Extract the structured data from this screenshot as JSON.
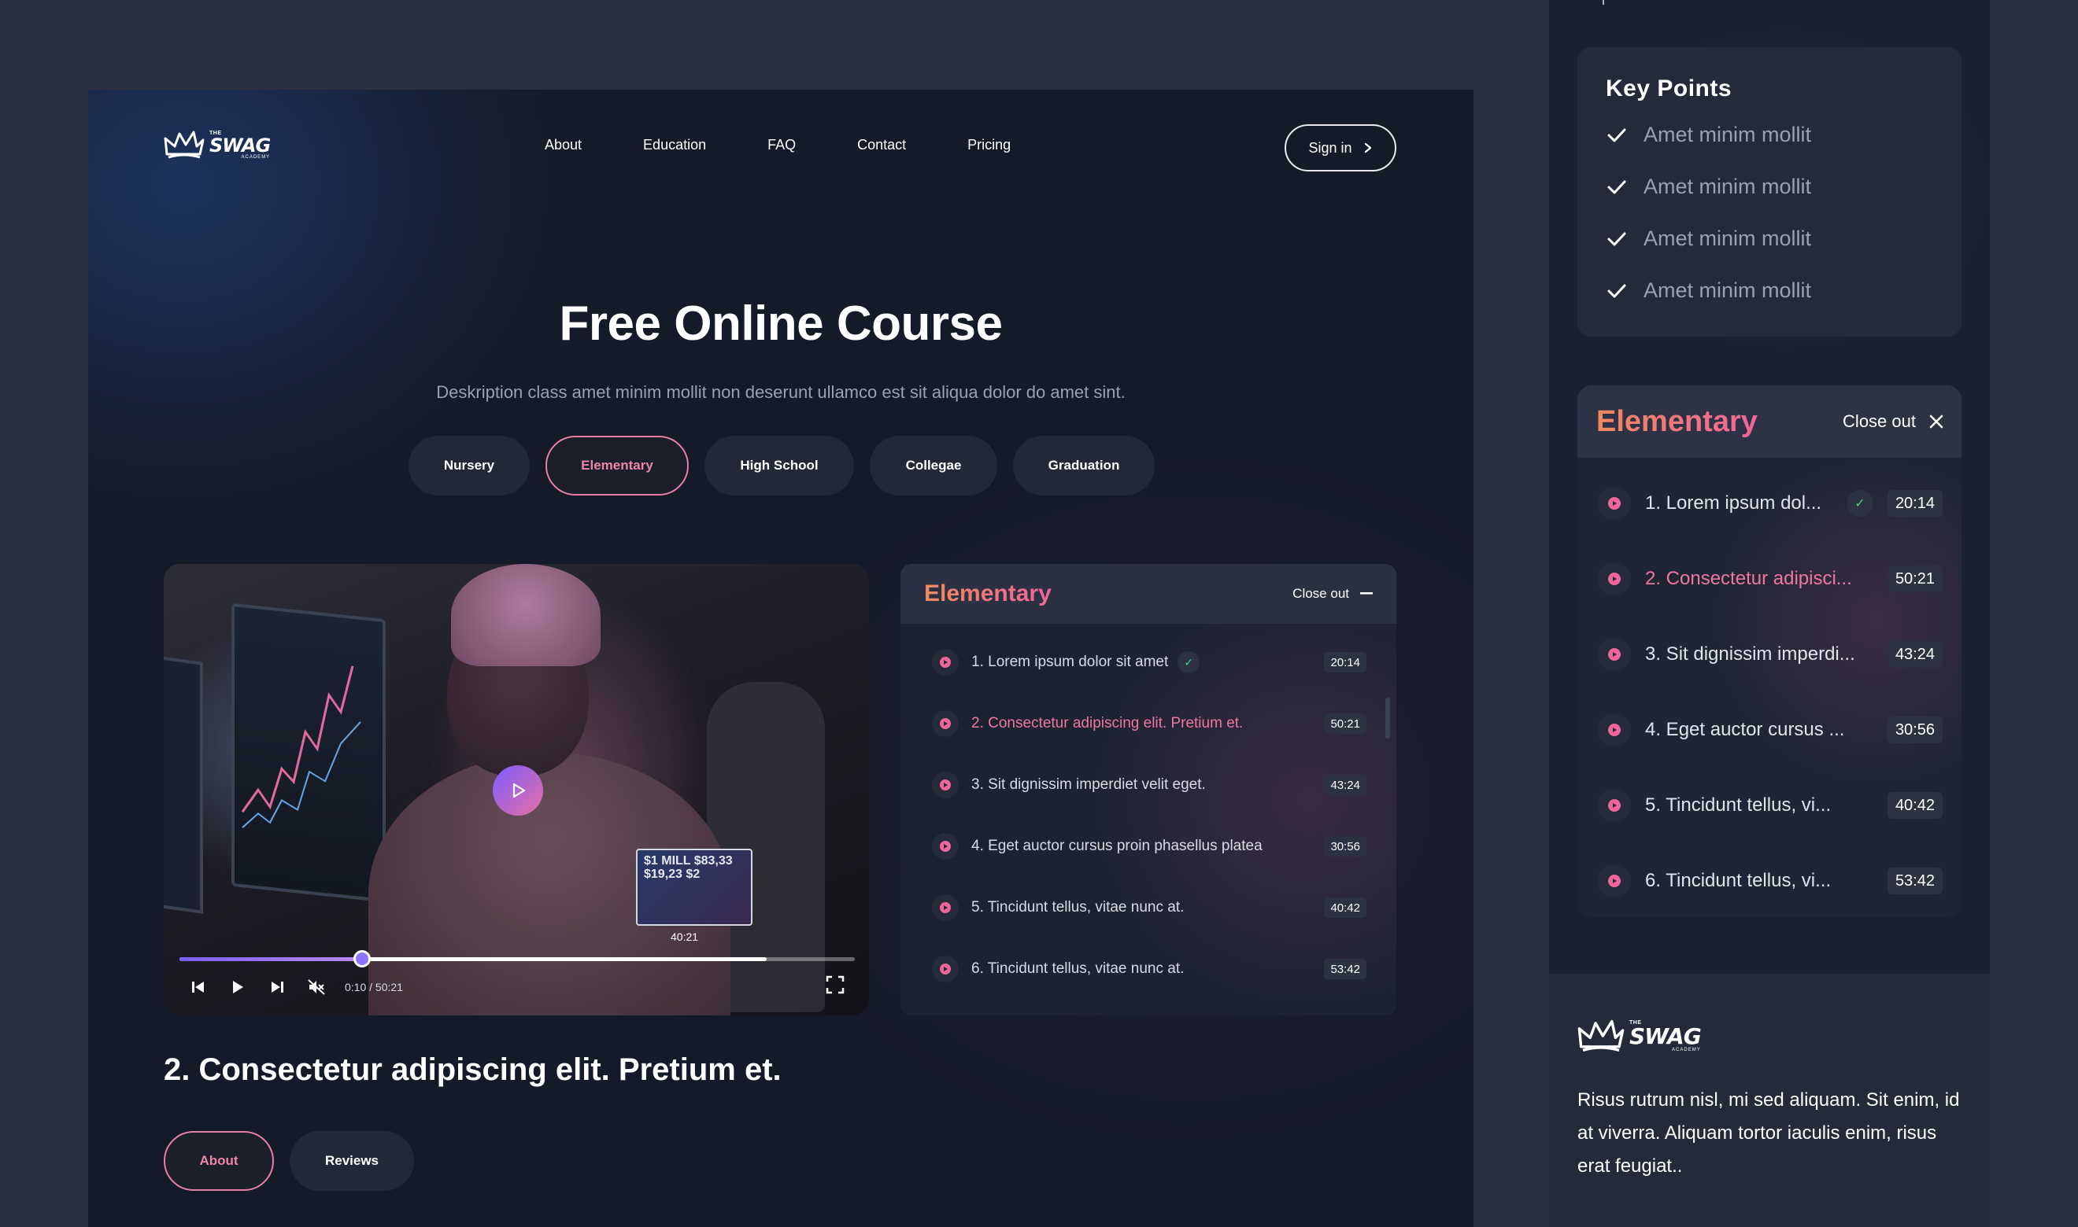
{
  "brand": {
    "the": "THE",
    "name": "SWAG",
    "sub": "ACADEMY"
  },
  "nav": {
    "links": [
      "About",
      "Education",
      "FAQ",
      "Contact",
      "Pricing"
    ],
    "signin": "Sign in"
  },
  "hero": {
    "title": "Free Online Course",
    "subtitle": "Deskription class amet minim mollit non deserunt ullamco est sit aliqua dolor do amet sint."
  },
  "levels": [
    {
      "label": "Nursery",
      "active": false
    },
    {
      "label": "Elementary",
      "active": true
    },
    {
      "label": "High School",
      "active": false
    },
    {
      "label": "Collegae",
      "active": false
    },
    {
      "label": "Graduation",
      "active": false
    }
  ],
  "video": {
    "preview_text": "$1 MILL $83,33 $19,23 $2",
    "preview_time": "40:21",
    "time": "0:10 / 50:21",
    "progress": 0.27,
    "buffered": 0.87
  },
  "playlist": {
    "title": "Elementary",
    "close_label": "Close out",
    "items": [
      {
        "title": "1. Lorem ipsum dolor sit amet",
        "duration": "20:14",
        "done": true,
        "active": false
      },
      {
        "title": "2. Consectetur adipiscing elit. Pretium et.",
        "duration": "50:21",
        "done": false,
        "active": true
      },
      {
        "title": "3. Sit dignissim imperdiet velit eget.",
        "duration": "43:24",
        "done": false,
        "active": false
      },
      {
        "title": "4. Eget auctor cursus proin phasellus platea",
        "duration": "30:56",
        "done": false,
        "active": false
      },
      {
        "title": "5. Tincidunt tellus, vitae nunc at.",
        "duration": "40:42",
        "done": false,
        "active": false
      },
      {
        "title": "6. Tincidunt tellus, vitae nunc at.",
        "duration": "53:42",
        "done": false,
        "active": false
      }
    ]
  },
  "lesson": {
    "title": "2. Consectetur adipiscing elit. Pretium et.",
    "tabs": [
      {
        "label": "About",
        "active": true
      },
      {
        "label": "Reviews",
        "active": false
      }
    ]
  },
  "key_points": {
    "title": "Key Points",
    "items": [
      "Amet minim mollit",
      "Amet minim mollit",
      "Amet minim mollit",
      "Amet minim mollit"
    ]
  },
  "mobile_playlist": {
    "title": "Elementary",
    "close_label": "Close out",
    "items": [
      {
        "title": "1. Lorem ipsum dol...",
        "duration": "20:14",
        "done": true,
        "active": false
      },
      {
        "title": "2. Consectetur adipisci...",
        "duration": "50:21",
        "done": false,
        "active": true
      },
      {
        "title": "3. Sit dignissim imperdi...",
        "duration": "43:24",
        "done": false,
        "active": false
      },
      {
        "title": "4. Eget auctor cursus ...",
        "duration": "30:56",
        "done": false,
        "active": false
      },
      {
        "title": "5. Tincidunt tellus, vi...",
        "duration": "40:42",
        "done": false,
        "active": false
      },
      {
        "title": "6. Tincidunt tellus, vi...",
        "duration": "53:42",
        "done": false,
        "active": false
      }
    ]
  },
  "footer": {
    "text": "Risus rutrum nisl, mi sed aliquam. Sit enim, id at viverra. Aliquam tortor iaculis enim, risus erat feugiat.."
  },
  "colors": {
    "accent_pink": "#ee789e",
    "accent_orange": "#f08a5d",
    "accent_purple": "#7b5cff",
    "check_green": "#4fd27d"
  }
}
